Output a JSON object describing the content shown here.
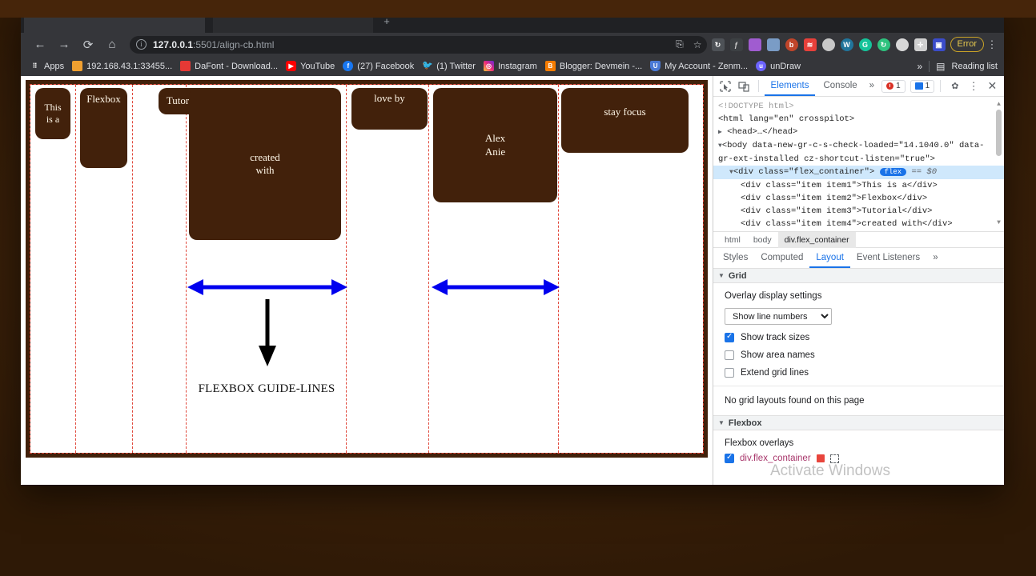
{
  "browser": {
    "nav": {
      "back": "back-arrow",
      "forward": "forward-arrow",
      "reload": "reload",
      "home": "home"
    },
    "omnibox": {
      "url_bold": "127.0.0.1",
      "url_rest": ":5501/align-cb.html",
      "info_icon": "ⓘ"
    },
    "toolbar_right": {
      "error_button": "Error",
      "kebab": "⋮"
    },
    "bookmarks": [
      {
        "label": "Apps",
        "icon": "apps-grid-icon",
        "color": "#4285f4"
      },
      {
        "label": "192.168.43.1:33455...",
        "icon": "hourglass-icon",
        "color": "#f0a030"
      },
      {
        "label": "DaFont - Download...",
        "icon": "dafont-icon",
        "color": "#e53935"
      },
      {
        "label": "YouTube",
        "icon": "youtube-icon",
        "color": "#ff0000"
      },
      {
        "label": "(27) Facebook",
        "icon": "facebook-icon",
        "color": "#1877f2"
      },
      {
        "label": "(1) Twitter",
        "icon": "twitter-icon",
        "color": "#1da1f2"
      },
      {
        "label": "Instagram",
        "icon": "instagram-icon",
        "color": "#d62976"
      },
      {
        "label": "Blogger: Devmein -...",
        "icon": "blogger-icon",
        "color": "#f57c00"
      },
      {
        "label": "My Account - Zenm...",
        "icon": "shield-icon",
        "color": "#4a7ad6"
      },
      {
        "label": "unDraw",
        "icon": "undraw-icon",
        "color": "#6c63ff"
      }
    ],
    "bookmarks_overflow": "»",
    "reading_list": "Reading list",
    "extensions": [
      {
        "name": "feather-icon",
        "color": "#a05cd0"
      },
      {
        "name": "screenshot-icon",
        "color": "#7a9cc6"
      },
      {
        "name": "bitwarden-icon",
        "color": "#c0452a"
      },
      {
        "name": "stacks-icon",
        "color": "#e8403a"
      },
      {
        "name": "ghost-icon",
        "color": "#c8c8c8"
      },
      {
        "name": "wordpress-icon",
        "color": "#21759b"
      },
      {
        "name": "grammarly-icon",
        "color": "#15c39a"
      },
      {
        "name": "refresh-sync-icon",
        "color": "#2ec27e"
      },
      {
        "name": "swirl-icon",
        "color": "#d8d8d8"
      },
      {
        "name": "puzzle-icon",
        "color": "#d0d0d0"
      },
      {
        "name": "window-icon",
        "color": "#3b4cca"
      }
    ]
  },
  "page": {
    "container_class": "flex_container",
    "items": [
      {
        "class": "item item1",
        "text": "This is a",
        "line1": "This",
        "line2": "is a"
      },
      {
        "class": "item item2",
        "text": "Flexbox",
        "line1": "Flexbox",
        "line2": ""
      },
      {
        "class": "item item3",
        "text": "Tutorial",
        "line1": "Tutorial",
        "line2": ""
      },
      {
        "class": "item item4",
        "text": "created with",
        "line1": "created",
        "line2": "with"
      },
      {
        "class": "item item5",
        "text": "love by",
        "line1": "love by",
        "line2": ""
      },
      {
        "class": "item item6",
        "text": "Alex Anie",
        "line1": "Alex",
        "line2": "Anie"
      },
      {
        "class": "item item7",
        "text": "stay focus",
        "line1": "stay focus",
        "line2": ""
      }
    ],
    "caption": "FLEXBOX GUIDE-LINES",
    "annotations": {
      "arrow_horizontal_left": "double-headed-horizontal-arrow",
      "arrow_horizontal_right": "double-headed-horizontal-arrow",
      "arrow_down": "down-arrow"
    },
    "colors": {
      "item_background": "#42210b",
      "item_text": "#fff7e8",
      "divider": "#e0473a",
      "arrow_blue": "#0000ee",
      "arrow_black": "#000000"
    }
  },
  "devtools": {
    "toolbar": {
      "inspect_icon": "inspect-cursor-icon",
      "device_icon": "device-toggle-icon",
      "tabs": [
        {
          "label": "Elements",
          "active": true
        },
        {
          "label": "Console",
          "active": false
        }
      ],
      "more_tabs": "»",
      "error_count": "1",
      "message_count": "1",
      "settings_icon": "gear-icon",
      "menu_icon": "kebab-icon",
      "close_icon": "close-icon"
    },
    "tree": [
      {
        "type": "doctype",
        "text": "<!DOCTYPE html>"
      },
      {
        "type": "open",
        "text": "<html lang=\"en\" crosspilot>"
      },
      {
        "type": "collapsed",
        "text": "<head>…</head>"
      },
      {
        "type": "open",
        "text": "<body data-new-gr-c-s-check-loaded=\"14.1040.0\" data-gr-ext-installed cz-shortcut-listen=\"true\">"
      },
      {
        "type": "selected",
        "text": "<div class=\"flex_container\">",
        "pill": "flex",
        "suffix": "== $0"
      },
      {
        "type": "child",
        "text": "<div class=\"item item1\">This is a</div>"
      },
      {
        "type": "child",
        "text": "<div class=\"item item2\">Flexbox</div>"
      },
      {
        "type": "child",
        "text": "<div class=\"item item3\">Tutorial</div>"
      },
      {
        "type": "child",
        "text": "<div class=\"item item4\">created with</div>"
      }
    ],
    "breadcrumb": [
      "html",
      "body",
      "div.flex_container"
    ],
    "subtabs": [
      {
        "label": "Styles",
        "active": false
      },
      {
        "label": "Computed",
        "active": false
      },
      {
        "label": "Layout",
        "active": true
      },
      {
        "label": "Event Listeners",
        "active": false
      },
      {
        "label": "»",
        "active": false
      }
    ],
    "grid": {
      "section_title": "Grid",
      "overlay_title": "Overlay display settings",
      "select_value": "Show line numbers",
      "checkboxes": [
        {
          "label": "Show track sizes",
          "checked": true
        },
        {
          "label": "Show area names",
          "checked": false
        },
        {
          "label": "Extend grid lines",
          "checked": false
        }
      ],
      "empty_note": "No grid layouts found on this page"
    },
    "flexbox": {
      "section_title": "Flexbox",
      "overlays_title": "Flexbox overlays",
      "overlay_item": {
        "label": "div.flex_container",
        "checked": true,
        "color": "#e8453c"
      }
    }
  },
  "watermark": "Activate Windows"
}
